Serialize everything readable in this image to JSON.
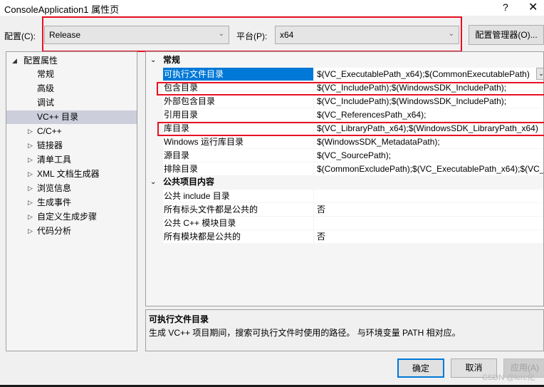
{
  "window": {
    "title": "ConsoleApplication1 属性页",
    "help": "?",
    "close": "✕"
  },
  "config": {
    "label": "配置(C):",
    "value": "Release",
    "platform_label": "平台(P):",
    "platform_value": "x64",
    "manager_button": "配置管理器(O)..."
  },
  "tree": {
    "root": "配置属性",
    "items": [
      {
        "label": "常规",
        "expandable": false
      },
      {
        "label": "高级",
        "expandable": false
      },
      {
        "label": "调试",
        "expandable": false
      },
      {
        "label": "VC++ 目录",
        "expandable": false,
        "selected": true
      },
      {
        "label": "C/C++",
        "expandable": true
      },
      {
        "label": "链接器",
        "expandable": true
      },
      {
        "label": "清单工具",
        "expandable": true
      },
      {
        "label": "XML 文档生成器",
        "expandable": true
      },
      {
        "label": "浏览信息",
        "expandable": true
      },
      {
        "label": "生成事件",
        "expandable": true
      },
      {
        "label": "自定义生成步骤",
        "expandable": true
      },
      {
        "label": "代码分析",
        "expandable": true
      }
    ]
  },
  "grid": {
    "cat1": "常规",
    "rows1": [
      {
        "key": "可执行文件目录",
        "value": "$(VC_ExecutablePath_x64);$(CommonExecutablePath)"
      },
      {
        "key": "包含目录",
        "value": "$(VC_IncludePath);$(WindowsSDK_IncludePath);"
      },
      {
        "key": "外部包含目录",
        "value": "$(VC_IncludePath);$(WindowsSDK_IncludePath);"
      },
      {
        "key": "引用目录",
        "value": "$(VC_ReferencesPath_x64);"
      },
      {
        "key": "库目录",
        "value": "$(VC_LibraryPath_x64);$(WindowsSDK_LibraryPath_x64)"
      },
      {
        "key": "Windows 运行库目录",
        "value": "$(WindowsSDK_MetadataPath);"
      },
      {
        "key": "源目录",
        "value": "$(VC_SourcePath);"
      },
      {
        "key": "排除目录",
        "value": "$(CommonExcludePath);$(VC_ExecutablePath_x64);$(VC_"
      }
    ],
    "cat2": "公共项目内容",
    "rows2": [
      {
        "key": "公共 include 目录",
        "value": ""
      },
      {
        "key": "所有标头文件都是公共的",
        "value": "否"
      },
      {
        "key": "公共 C++ 模块目录",
        "value": ""
      },
      {
        "key": "所有模块都是公共的",
        "value": "否"
      }
    ]
  },
  "description": {
    "title": "可执行文件目录",
    "text": "生成 VC++ 项目期间，搜索可执行文件时使用的路径。 与环境变量 PATH 相对应。"
  },
  "buttons": {
    "ok": "确定",
    "cancel": "取消",
    "apply": "应用(A)"
  },
  "watermark": "CSDN @lerc化",
  "colors": {
    "selection": "#0078d7",
    "highlight_box": "#e81123",
    "tree_selection": "#cccedb"
  }
}
